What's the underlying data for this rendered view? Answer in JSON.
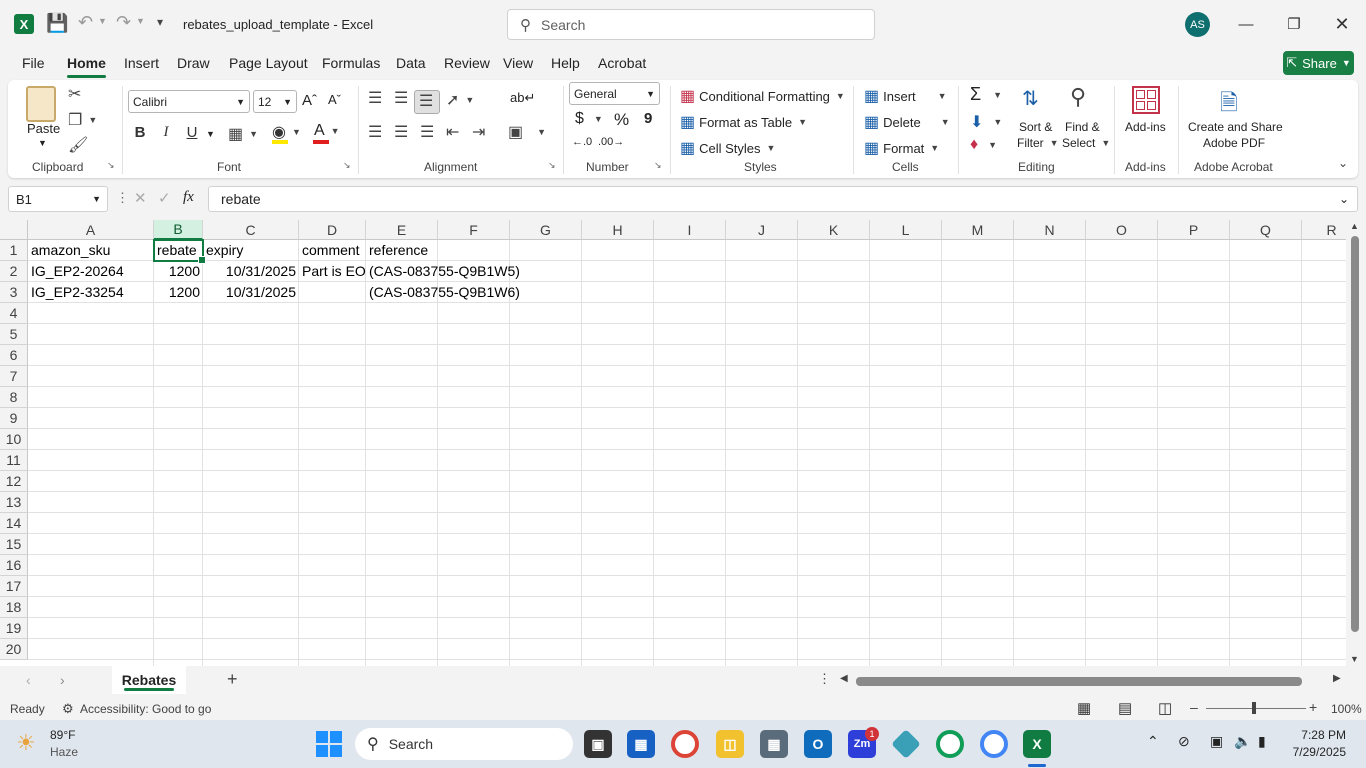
{
  "title_bar": {
    "filename": "rebates_upload_template",
    "app": "Excel",
    "title_sep": "-",
    "search_placeholder": "Search",
    "avatar_initials": "AS"
  },
  "tabs": [
    "File",
    "Home",
    "Insert",
    "Draw",
    "Page Layout",
    "Formulas",
    "Data",
    "Review",
    "View",
    "Help",
    "Acrobat"
  ],
  "active_tab": "Home",
  "share_label": "Share",
  "ribbon": {
    "clipboard": {
      "paste": "Paste",
      "label": "Clipboard"
    },
    "font": {
      "name": "Calibri",
      "size": "12",
      "bold": "B",
      "italic": "I",
      "underline": "U",
      "label": "Font"
    },
    "alignment": {
      "label": "Alignment"
    },
    "number": {
      "format": "General",
      "currency": "$",
      "percent": "%",
      "comma": "9",
      "label": "Number"
    },
    "styles": {
      "conditional": "Conditional Formatting",
      "format_table": "Format as Table",
      "cell_styles": "Cell Styles",
      "label": "Styles"
    },
    "cells": {
      "insert": "Insert",
      "delete": "Delete",
      "format": "Format",
      "label": "Cells"
    },
    "editing": {
      "sort1": "Sort &",
      "sort2": "Filter",
      "find1": "Find &",
      "find2": "Select",
      "label": "Editing"
    },
    "addins": {
      "button": "Add-ins",
      "label": "Add-ins"
    },
    "acrobat": {
      "line1": "Create and Share",
      "line2": "Adobe PDF",
      "label": "Adobe Acrobat"
    }
  },
  "formula_bar": {
    "name_box": "B1",
    "fx": "fx",
    "value": "rebate"
  },
  "columns": [
    "A",
    "B",
    "C",
    "D",
    "E",
    "F",
    "G",
    "H",
    "I",
    "J",
    "K",
    "L",
    "M",
    "N",
    "O",
    "P",
    "Q",
    "R"
  ],
  "rows": [
    "1",
    "2",
    "3",
    "4",
    "5",
    "6",
    "7",
    "8",
    "9",
    "10",
    "11",
    "12",
    "13",
    "14",
    "15",
    "16",
    "17",
    "18",
    "19",
    "20"
  ],
  "cells": {
    "r1": [
      "amazon_sku",
      "rebate",
      "expiry",
      "comment",
      "reference"
    ],
    "r2": [
      "IG_EP2-20264",
      "1200",
      "10/31/2025",
      "Part is EO",
      "(CAS-083755-Q9B1W5)"
    ],
    "r3": [
      "IG_EP2-33254",
      "1200",
      "10/31/2025",
      "",
      "(CAS-083755-Q9B1W6)"
    ]
  },
  "sheet_tab": "Rebates",
  "status": {
    "ready": "Ready",
    "accessibility": "Accessibility: Good to go",
    "zoom": "100%"
  },
  "taskbar": {
    "weather_temp": "89°F",
    "weather_desc": "Haze",
    "search": "Search",
    "badge": "1",
    "time": "7:28 PM",
    "date": "7/29/2025"
  }
}
